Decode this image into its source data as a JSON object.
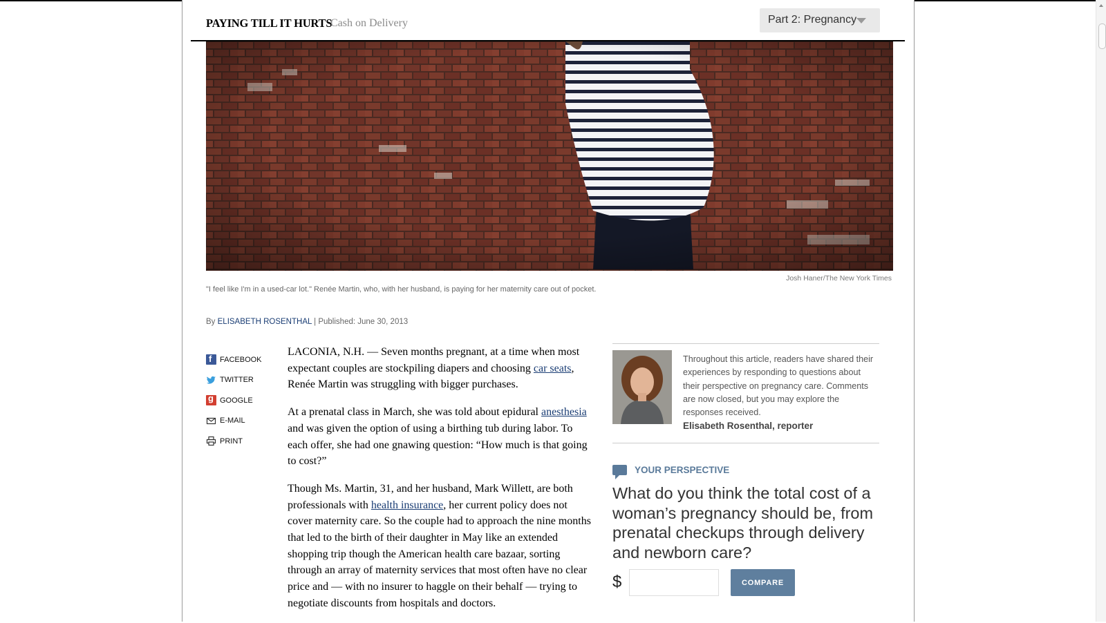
{
  "header": {
    "series": "PAYING TILL IT HURTS",
    "subseries": "Cash on Delivery",
    "part_selector": "Part 2: Pregnancy"
  },
  "photo": {
    "credit": "Josh Haner/The New York Times",
    "caption": "\"I feel like I'm in a used-car lot.\" Renée Martin, who, with her husband, is paying for her maternity care out of pocket."
  },
  "byline": {
    "by": "By",
    "author": "ELISABETH ROSENTHAL",
    "published": " | Published: June 30, 2013"
  },
  "share": [
    {
      "label": "FACEBOOK",
      "icon": "facebook-icon"
    },
    {
      "label": "TWITTER",
      "icon": "twitter-icon"
    },
    {
      "label": "GOOGLE",
      "icon": "google-plus-icon"
    },
    {
      "label": "E-MAIL",
      "icon": "email-icon"
    },
    {
      "label": "PRINT",
      "icon": "print-icon"
    }
  ],
  "article": {
    "p1_a": "LACONIA, N.H. — Seven months pregnant, at a time when most expectant couples are stockpiling diapers and choosing ",
    "p1_link": "car seats",
    "p1_b": ", Renée Martin was struggling with bigger purchases.",
    "p2_a": "At a prenatal class in March, she was told about epidural ",
    "p2_link": "anesthesia",
    "p2_b": " and was given the option of using a birthing tub during labor. To each offer, she had one gnawing question: “How much is that going to cost?”",
    "p3_a": "Though Ms. Martin, 31, and her husband, Mark Willett, are both professionals with ",
    "p3_link": "health insurance",
    "p3_b": ", her current policy does not cover maternity care. So the couple had to approach the nine months that led to the birth of their daughter in May like an extended shopping trip though the American health care bazaar, sorting through an array of maternity services that most often have no clear price and — with no insurer to haggle on their behalf — trying to negotiate discounts from hospitals and doctors."
  },
  "sidebar": {
    "reporter_note": "Throughout this article, readers have shared their experiences by responding to questions about their perspective on pregnancy care. Comments are now closed, but you may explore the responses received.",
    "reporter_name": "Elisabeth Rosenthal, reporter",
    "perspective_label": "YOUR PERSPECTIVE",
    "question": "What do you think the total cost of a woman’s pregnancy should be, from prenatal checkups through delivery and newborn care?",
    "currency": "$",
    "amount_value": "",
    "compare_label": "COMPARE"
  },
  "colors": {
    "link": "#1a3d74",
    "perspective_accent": "#5a7a9a",
    "compare_button": "#5f7f9e"
  }
}
